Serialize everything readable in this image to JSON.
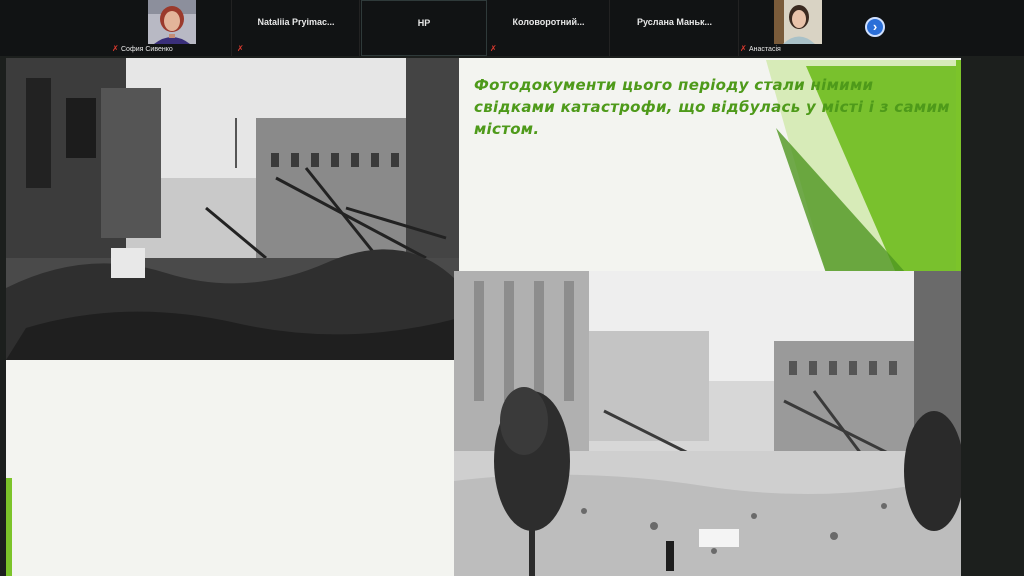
{
  "participants": [
    {
      "id": "sofia",
      "name": "София Сивенко",
      "muted": true,
      "has_video": true
    },
    {
      "id": "nataliia",
      "name": "Nataliia Pryimac...",
      "muted": true,
      "has_video": false
    },
    {
      "id": "hp",
      "name": "HP",
      "muted": false,
      "has_video": false,
      "active": true
    },
    {
      "id": "kolovorotnyi",
      "name": "Коловоротний...",
      "muted": true,
      "has_video": false
    },
    {
      "id": "ruslana",
      "name": "Руслана Маньк...",
      "muted": false,
      "has_video": false
    },
    {
      "id": "anastasia",
      "name": "Анастасія",
      "muted": true,
      "has_video": true
    }
  ],
  "strip": {
    "next_icon": "chevron-right-icon"
  },
  "slide": {
    "text": "Фотодокументи цього періоду стали німими свідками катастрофи, що відбулась у місті і з самим містом.",
    "accent_color": "#6cc21f",
    "text_color": "#4e9a1a",
    "photos": [
      "ruined-building-photo-top",
      "ruined-street-photo-bottom"
    ]
  }
}
